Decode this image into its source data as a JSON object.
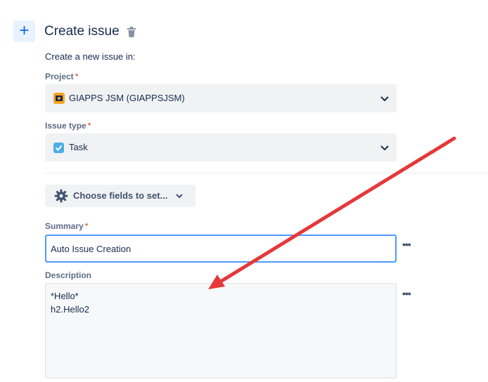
{
  "header": {
    "plus_icon": "+",
    "title": "Create issue"
  },
  "subtitle": "Create a new issue in:",
  "project": {
    "label": "Project",
    "required": "*",
    "value": "GIAPPS JSM (GIAPPSJSM)",
    "icon_color": "#f5a623"
  },
  "issue_type": {
    "label": "Issue type",
    "required": "*",
    "value": "Task",
    "icon_color": "#4bade8"
  },
  "choose_fields": {
    "label": "Choose fields to set..."
  },
  "summary": {
    "label": "Summary",
    "required": "*",
    "value": "Auto Issue Creation",
    "more": "•••"
  },
  "description": {
    "label": "Description",
    "lines": [
      "*Hello*",
      "h2.Hello2"
    ],
    "more": "•••"
  },
  "colors": {
    "accent": "#0c66e4",
    "annotation_arrow": "#e5383b"
  }
}
